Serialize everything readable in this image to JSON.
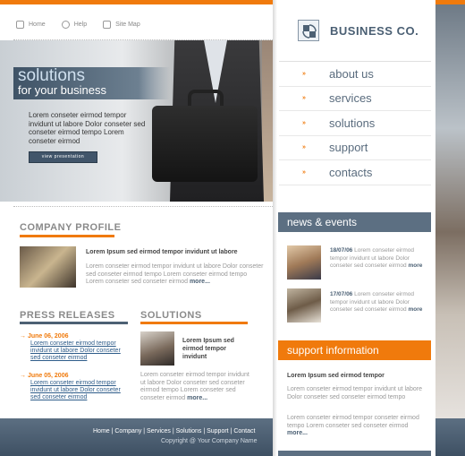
{
  "topnav": {
    "home": "Home",
    "help": "Help",
    "sitemap": "Site Map"
  },
  "hero": {
    "title1": "solutions",
    "title2": "for your business",
    "text": "Lorem conseter eirmod tempor invidunt ut labore Dolor conseter sed conseter eirmod tempo Lorem conseter eirmod",
    "button": "view presentation"
  },
  "company_profile": {
    "title": "COMPANY PROFILE",
    "heading": "Lorem Ipsum sed eirmod tempor invidunt ut labore",
    "text": "Lorem conseter eirmod tempor invidunt ut labore Dolor conseter sed conseter eirmod tempo Lorem conseter eirmod tempo Lorem conseter sed conseter eirmod",
    "more": "more..."
  },
  "press": {
    "title": "PRESS RELEASES",
    "items": [
      {
        "date": "June 06, 2006",
        "text": "Lorem conseter eirmod tempor invidunt ut labore Dolor conseter sed conseter eirmod"
      },
      {
        "date": "June 05, 2006",
        "text": "Lorem conseter eirmod tempor invidunt ut labore Dolor conseter sed conseter eirmod"
      }
    ]
  },
  "solutions": {
    "title": "SOLUTIONS",
    "heading": "Lorem Ipsum sed eirmod tempor invidunt",
    "text": "Lorem conseter eirmod tempor invidunt ut labore Dolor conseter sed conseter eirmod tempo Lorem conseter sed conseter eirmod",
    "more": "more..."
  },
  "footer": {
    "nav": "Home | Company | Services | Solutions | Support | Contact",
    "copyright": "Copyright @ Your Company Name"
  },
  "logo": {
    "text": "BUSINESS CO."
  },
  "menu": [
    {
      "label": "about us"
    },
    {
      "label": "services"
    },
    {
      "label": "solutions"
    },
    {
      "label": "support"
    },
    {
      "label": "contacts"
    }
  ],
  "news": {
    "title": "news & events",
    "items": [
      {
        "date": "18/07/06",
        "text": "Lorem conseter eirmod tempor invidunt ut labore Dolor conseter sed conseter eirmod",
        "more": "more"
      },
      {
        "date": "17/07/06",
        "text": "Lorem conseter eirmod tempor invidunt ut labore Dolor conseter sed conseter eirmod",
        "more": "more"
      }
    ]
  },
  "support": {
    "title": "support information",
    "heading": "Lorem Ipsum sed eirmod tempor",
    "p1": "Lorem conseter eirmod tempor invidunt ut labore Dolor conseter sed conseter eirmod tempo",
    "p2": "Lorem conseter eirmod tempor conseter eirmod tempo Lorem conseter sed conseter eirmod",
    "more": "more..."
  },
  "colors": {
    "accent": "#f07a0c",
    "brand": "#4d6174"
  }
}
